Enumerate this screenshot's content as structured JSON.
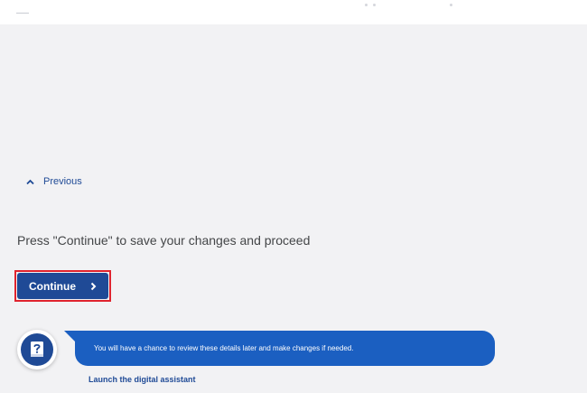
{
  "header": {
    "logo_icon": "logo-mark"
  },
  "navigation": {
    "previous_label": "Previous",
    "previous_icon": "chevron-up-icon"
  },
  "main": {
    "instruction": "Press \"Continue\" to save your changes and proceed",
    "continue_label": "Continue",
    "continue_icon": "chevron-right-icon"
  },
  "assistant": {
    "icon": "help-book-icon",
    "message": "You will have a chance to review these details later and make changes if needed.",
    "launch_label": "Launch the digital assistant"
  },
  "colors": {
    "background": "#f2f2f4",
    "primary": "#1f4a96",
    "bubble": "#1b5fc1",
    "highlight": "#e0242e",
    "text": "#444648"
  }
}
